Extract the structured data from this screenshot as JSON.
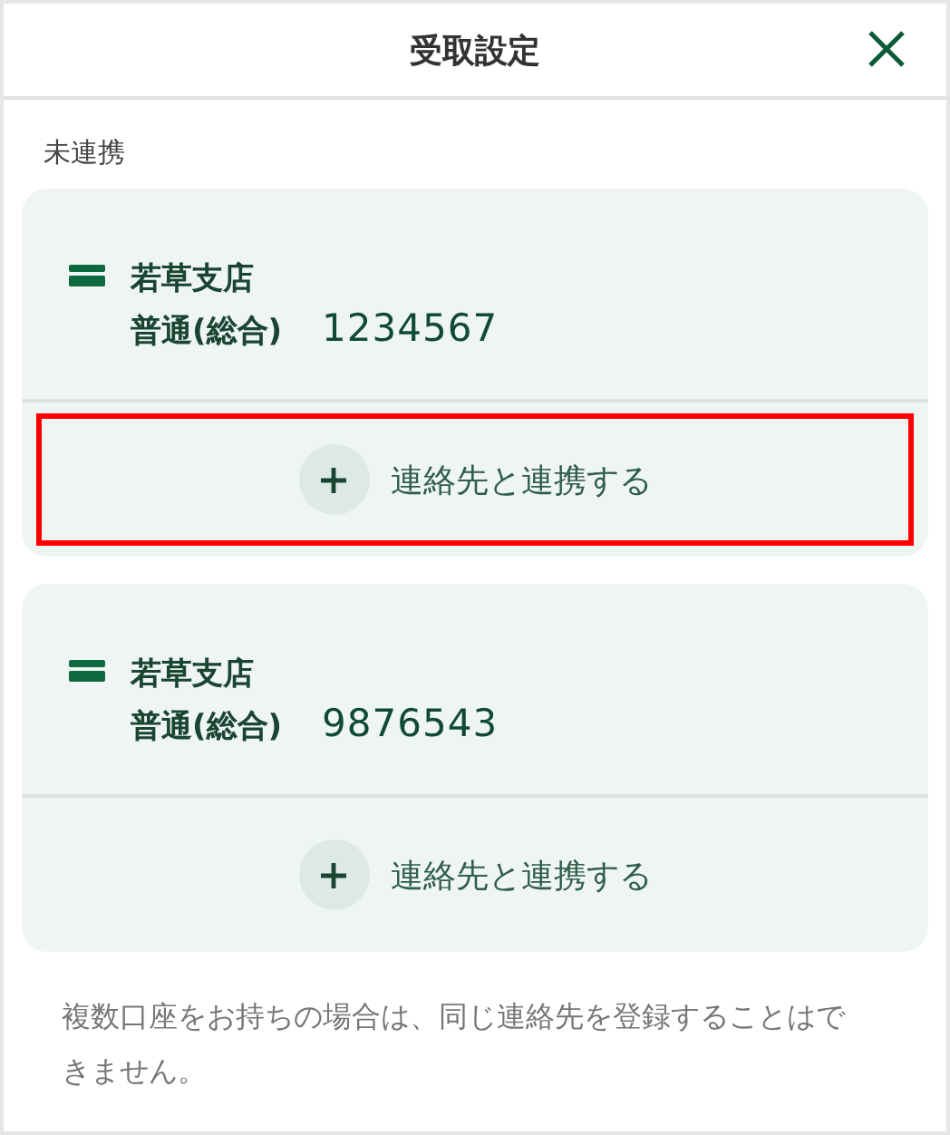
{
  "header": {
    "title": "受取設定"
  },
  "section_label": "未連携",
  "accounts": [
    {
      "branch": "若草支店",
      "type": "普通(総合)",
      "number": "1234567",
      "action": "連絡先と連携する",
      "highlighted": true
    },
    {
      "branch": "若草支店",
      "type": "普通(総合)",
      "number": "9876543",
      "action": "連絡先と連携する",
      "highlighted": false
    }
  ],
  "note": "複数口座をお持ちの場合は、同じ連絡先を登録することはできません。"
}
